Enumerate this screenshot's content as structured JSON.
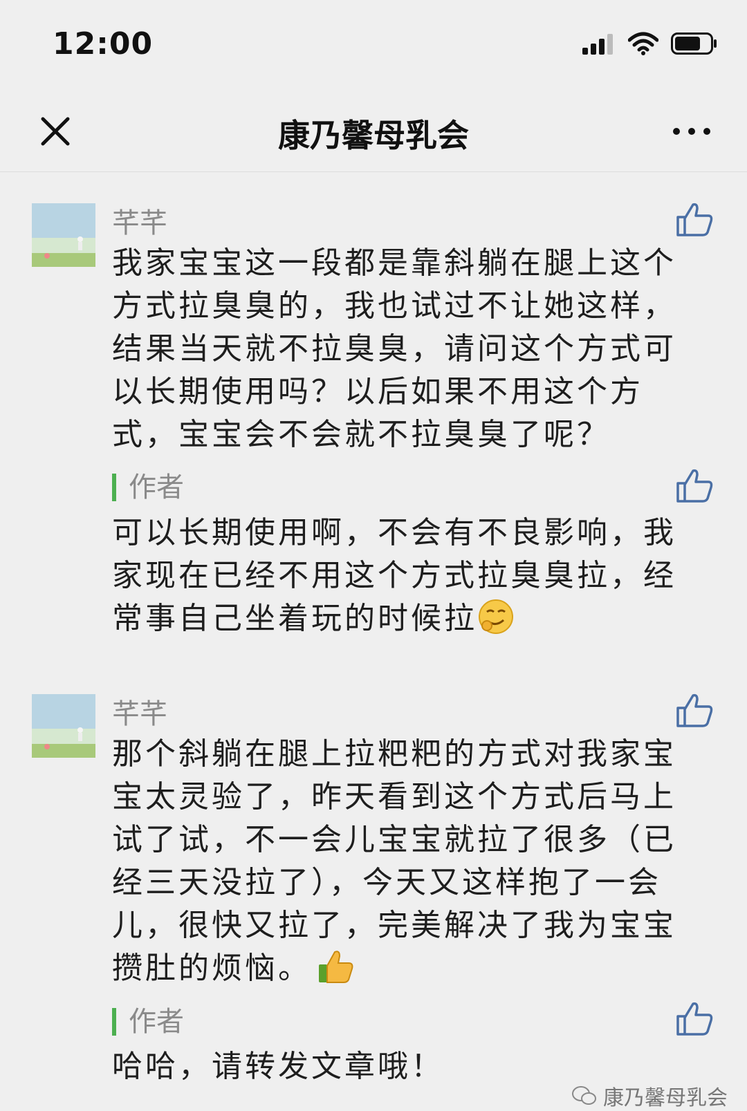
{
  "status_bar": {
    "time": "12:00"
  },
  "nav": {
    "title": "康乃馨母乳会"
  },
  "comments": [
    {
      "nickname": "芊芊",
      "text": "我家宝宝这一段都是靠斜躺在腿上这个方式拉臭臭的，我也试过不让她这样，结果当天就不拉臭臭，请问这个方式可以长期使用吗？以后如果不用这个方式，宝宝会不会就不拉臭臭了呢？",
      "reply_label": "作者",
      "reply_text": "可以长期使用啊，不会有不良影响，我家现在已经不用这个方式拉臭臭拉，经常事自己坐着玩的时候拉",
      "reply_emoji": "smirk-emoji"
    },
    {
      "nickname": "芊芊",
      "text": "那个斜躺在腿上拉粑粑的方式对我家宝宝太灵验了，昨天看到这个方式后马上试了试，不一会儿宝宝就拉了很多（已经三天没拉了），今天又这样抱了一会儿，很快又拉了，完美解决了我为宝宝攒肚的烦恼。",
      "text_emoji": "thumbs-up-emoji",
      "reply_label": "作者",
      "reply_text": "哈哈，请转发文章哦！"
    }
  ],
  "watermark": {
    "text": "康乃馨母乳会"
  },
  "colors": {
    "accent": "#4caf50",
    "background": "#efefef",
    "like_icon": "#4a6fa5"
  }
}
